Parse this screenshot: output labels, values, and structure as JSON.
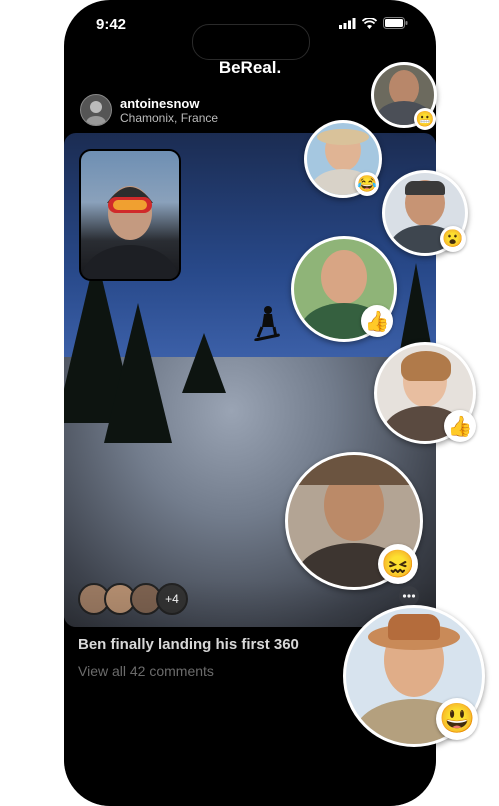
{
  "status_bar": {
    "time": "9:42"
  },
  "app": {
    "title": "BeReal."
  },
  "post": {
    "username": "antoinesnow",
    "location": "Chamonix, France",
    "caption": "Ben finally landing his first 360",
    "comments_link": "View all 42 comments",
    "reaction_avatars_more": "+4"
  },
  "realmojis": [
    {
      "emoji": "😬",
      "name": "grimace"
    },
    {
      "emoji": "😂",
      "name": "laugh"
    },
    {
      "emoji": "😮",
      "name": "surprised"
    },
    {
      "emoji": "👍",
      "name": "thumbs-up"
    },
    {
      "emoji": "👍",
      "name": "thumbs-up"
    },
    {
      "emoji": "😖",
      "name": "confounded"
    },
    {
      "emoji": "😃",
      "name": "happy"
    }
  ],
  "icons": [
    "signal-icon",
    "wifi-icon",
    "battery-icon",
    "more-icon"
  ],
  "colors": {
    "background": "#000000",
    "page": "#ffffff",
    "accent": "#ffffff",
    "muted": "#8a8a8a"
  }
}
